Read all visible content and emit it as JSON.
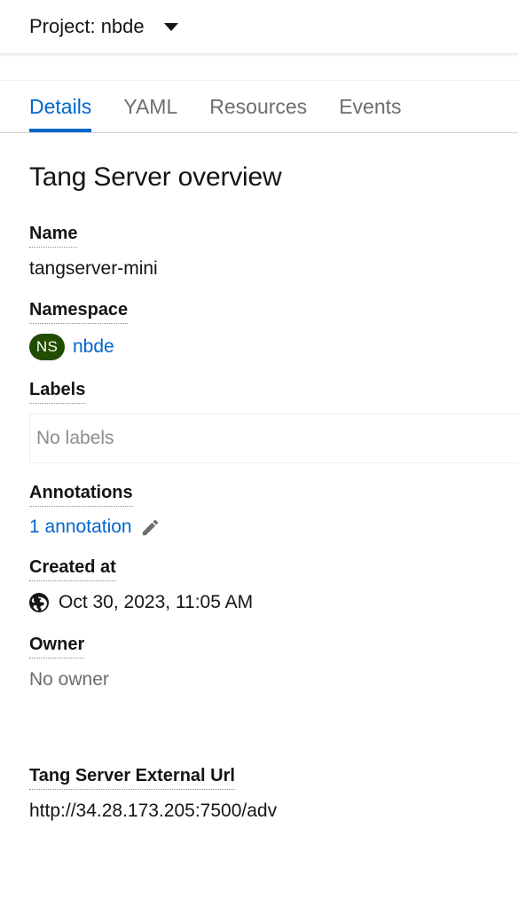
{
  "project_bar": {
    "selector_label": "Project: nbde",
    "caret_icon": "chevron-down-icon"
  },
  "tabs": [
    {
      "label": "Details",
      "active": true
    },
    {
      "label": "YAML",
      "active": false
    },
    {
      "label": "Resources",
      "active": false
    },
    {
      "label": "Events",
      "active": false
    }
  ],
  "main": {
    "page_title": "Tang Server overview",
    "fields": {
      "name": {
        "label": "Name",
        "value": "tangserver-mini"
      },
      "namespace": {
        "label": "Namespace",
        "badge": "NS",
        "badge_color": "#204d00",
        "value": "nbde"
      },
      "labels": {
        "label": "Labels",
        "empty_text": "No labels"
      },
      "annotations": {
        "label": "Annotations",
        "value": "1 annotation",
        "edit_icon": "pencil-icon"
      },
      "created_at": {
        "label": "Created at",
        "icon": "globe-icon",
        "value": "Oct 30, 2023, 11:05 AM"
      },
      "owner": {
        "label": "Owner",
        "value": "No owner"
      },
      "external_url": {
        "label": "Tang Server External Url",
        "value": "http://34.28.173.205:7500/adv"
      }
    }
  },
  "theme": {
    "link_color": "#0066cc",
    "active_tab_color": "#0066cc",
    "muted_text_color": "#6a6e73",
    "text_color": "#151515"
  }
}
